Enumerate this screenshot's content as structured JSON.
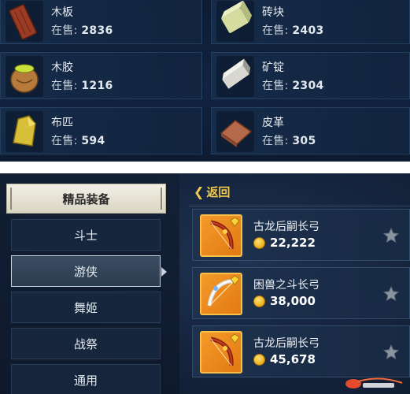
{
  "materials": [
    {
      "name": "木板",
      "stock_label": "在售:",
      "stock": "2836",
      "icon": "wood-plank-icon"
    },
    {
      "name": "砖块",
      "stock_label": "在售:",
      "stock": "2403",
      "icon": "brick-icon"
    },
    {
      "name": "木胶",
      "stock_label": "在售:",
      "stock": "1216",
      "icon": "glue-pot-icon"
    },
    {
      "name": "矿锭",
      "stock_label": "在售:",
      "stock": "2304",
      "icon": "ingot-icon"
    },
    {
      "name": "布匹",
      "stock_label": "在售:",
      "stock": "594",
      "icon": "cloth-icon"
    },
    {
      "name": "皮革",
      "stock_label": "在售:",
      "stock": "305",
      "icon": "leather-icon"
    }
  ],
  "shop": {
    "category_header": "精品装备",
    "categories": [
      "斗士",
      "游侠",
      "舞姬",
      "战祭",
      "通用"
    ],
    "active_category": "游侠",
    "back_label": "返回",
    "items": [
      {
        "name": "古龙后嗣长弓",
        "price": "22,222",
        "icon": "bow-icon"
      },
      {
        "name": "困兽之斗长弓",
        "price": "38,000",
        "icon": "bow-icon"
      },
      {
        "name": "古龙后嗣长弓",
        "price": "45,678",
        "icon": "bow-icon"
      }
    ]
  },
  "colors": {
    "accent": "#f2c94c",
    "panel_bg": "#15243d",
    "item_icon_bg": "#f39a2a"
  }
}
